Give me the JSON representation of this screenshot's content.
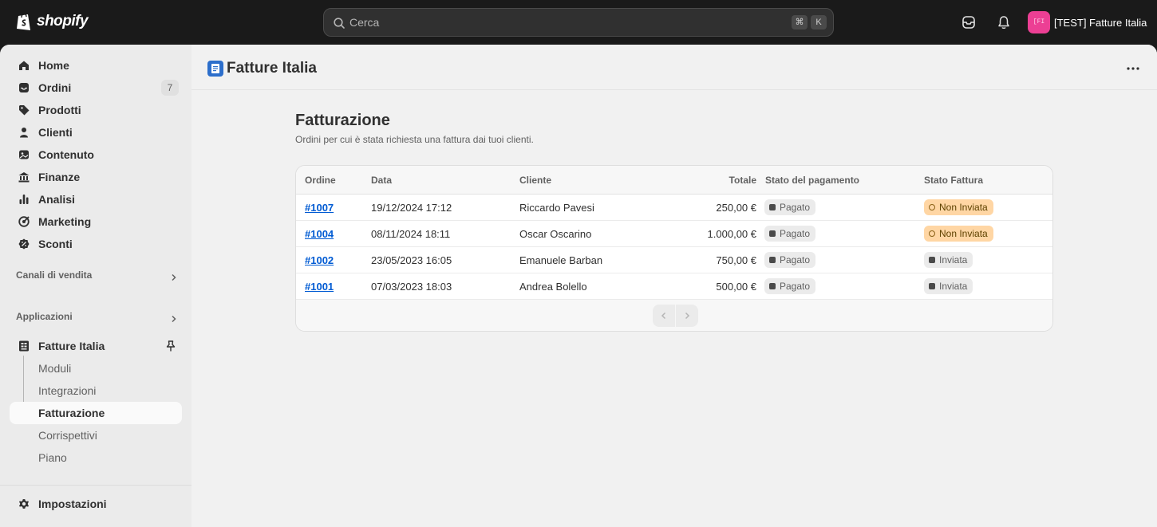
{
  "topbar": {
    "logo_text": "shopify",
    "search_placeholder": "Cerca",
    "shortcut_keys": [
      "⌘",
      "K"
    ],
    "store_avatar": "[FI",
    "store_name": "[TEST] Fatture Italia"
  },
  "sidebar": {
    "items": [
      {
        "label": "Home",
        "icon": "home-icon"
      },
      {
        "label": "Ordini",
        "icon": "inbox-icon",
        "badge": "7"
      },
      {
        "label": "Prodotti",
        "icon": "tag-icon"
      },
      {
        "label": "Clienti",
        "icon": "person-icon"
      },
      {
        "label": "Contenuto",
        "icon": "content-icon"
      },
      {
        "label": "Finanze",
        "icon": "bank-icon"
      },
      {
        "label": "Analisi",
        "icon": "bar-chart-icon"
      },
      {
        "label": "Marketing",
        "icon": "target-icon"
      },
      {
        "label": "Sconti",
        "icon": "discount-icon"
      }
    ],
    "sales_channels_label": "Canali di vendita",
    "apps_label": "Applicazioni",
    "app": {
      "label": "Fatture Italia",
      "subitems": [
        "Moduli",
        "Integrazioni",
        "Fatturazione",
        "Corrispettivi",
        "Piano"
      ],
      "active": "Fatturazione"
    },
    "settings_label": "Impostazioni"
  },
  "main": {
    "app_title": "Fatture Italia",
    "page_title": "Fatturazione",
    "page_subtitle": "Ordini per cui è stata richiesta una fattura dai tuoi clienti.",
    "table": {
      "headers": [
        "Ordine",
        "Data",
        "Cliente",
        "Totale",
        "Stato del pagamento",
        "Stato Fattura"
      ],
      "rows": [
        {
          "order": "#1007",
          "date": "19/12/2024 17:12",
          "customer": "Riccardo Pavesi",
          "total": "250,00 €",
          "payment": "Pagato",
          "invoice": "Non Inviata"
        },
        {
          "order": "#1004",
          "date": "08/11/2024 18:11",
          "customer": "Oscar Oscarino",
          "total": "1.000,00 €",
          "payment": "Pagato",
          "invoice": "Non Inviata"
        },
        {
          "order": "#1002",
          "date": "23/05/2023 16:05",
          "customer": "Emanuele Barban",
          "total": "750,00 €",
          "payment": "Pagato",
          "invoice": "Inviata"
        },
        {
          "order": "#1001",
          "date": "07/03/2023 18:03",
          "customer": "Andrea Bolello",
          "total": "500,00 €",
          "payment": "Pagato",
          "invoice": "Inviata"
        }
      ]
    }
  },
  "colors": {
    "topbar_bg": "#1a1a1a",
    "link": "#005bd3",
    "pill_warning_bg": "#ffd6a4",
    "pill_neutral_bg": "#ebebeb",
    "store_avatar_bg": "#ec3f94"
  }
}
